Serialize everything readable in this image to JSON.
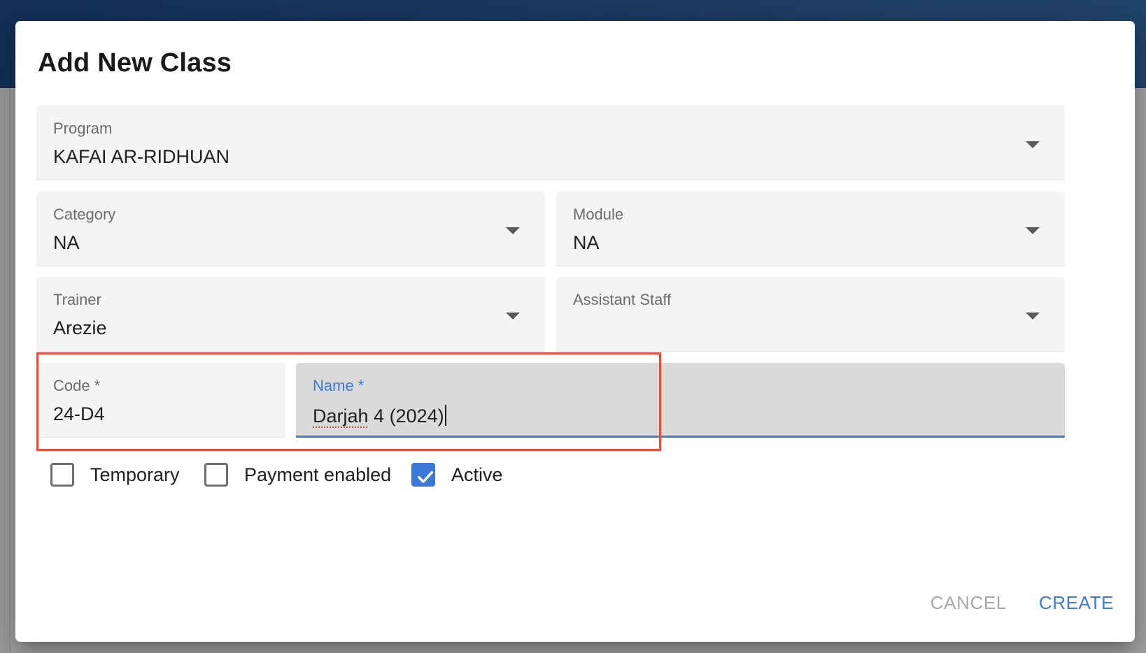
{
  "dialog": {
    "title": "Add New Class"
  },
  "fields": {
    "program": {
      "label": "Program",
      "value": "KAFAI AR-RIDHUAN"
    },
    "category": {
      "label": "Category",
      "value": "NA"
    },
    "module": {
      "label": "Module",
      "value": "NA"
    },
    "trainer": {
      "label": "Trainer",
      "value": "Arezie"
    },
    "assistant_staff": {
      "label": "Assistant Staff",
      "value": ""
    },
    "code": {
      "label": "Code *",
      "value": "24-D4"
    },
    "name": {
      "label": "Name *",
      "value_misspelled": "Darjah",
      "value_rest": " 4 (2024)"
    }
  },
  "checkboxes": [
    {
      "label": "Temporary",
      "checked": false
    },
    {
      "label": "Payment enabled",
      "checked": false
    },
    {
      "label": "Active",
      "checked": true
    }
  ],
  "actions": {
    "cancel_label": "CANCEL",
    "create_label": "CREATE"
  },
  "colors": {
    "accent": "#3f7bd6",
    "highlight": "#e0503e",
    "topbar": "#1e4a86"
  },
  "icons": {
    "dropdown": "chevron-down-icon",
    "check": "check-icon"
  }
}
